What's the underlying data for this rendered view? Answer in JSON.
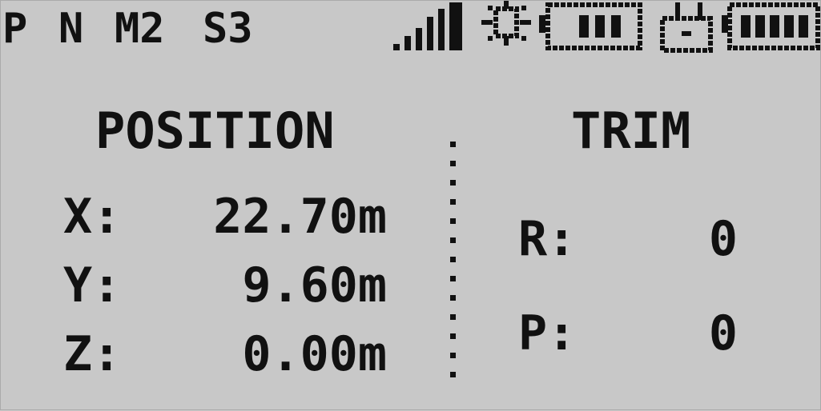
{
  "status_bar": {
    "mode_p": "P",
    "mode_n": "N",
    "mode_m": "M2",
    "mode_s": "S3",
    "signal_level": 5,
    "icons": [
      "signal-icon",
      "fan-icon",
      "battery-icon",
      "transmitter-icon",
      "transmitter-battery-icon"
    ],
    "battery_bars": 3,
    "tx_battery_bars": 5
  },
  "position": {
    "title": "POSITION",
    "rows": [
      {
        "label": "X:",
        "value": "22.70m"
      },
      {
        "label": "Y:",
        "value": "9.60m"
      },
      {
        "label": "Z:",
        "value": "0.00m"
      }
    ]
  },
  "trim": {
    "title": "TRIM",
    "rows": [
      {
        "label": "R:",
        "value": "0"
      },
      {
        "label": "P:",
        "value": "0"
      }
    ]
  },
  "colors": {
    "background": "#c8c8c8",
    "pixel": "#111111"
  }
}
